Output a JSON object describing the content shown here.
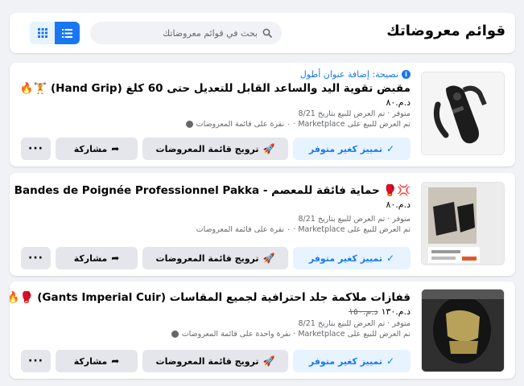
{
  "header": {
    "title": "قوائم معروضاتك",
    "search_placeholder": "بحث في قوائم معروضاتك"
  },
  "buttons": {
    "boost": "تمييز كغير متوفر",
    "promote": "ترويج قائمة المعروضات",
    "share": "مشاركة",
    "more": "···"
  },
  "listings": [
    {
      "tip": "نصيحة: إضافة عنوان أطول",
      "title": "مقبض تقوية اليد والساعد القابل للتعديل حتى 60 كلغ (Hand Grip) 🏋️🔥",
      "price": "د.م.٨٠",
      "old_price": "",
      "status": "متوفر · تم العرض للبيع بتاريخ 8/21",
      "views": "تم العرض للبيع على Marketplace · ٠ نقرة على قائمة المعروضات"
    },
    {
      "tip": "",
      "title": "💢🥊 حماية فائقة للمعصم - Bandes de Poignée Professionnel Pakka",
      "price": "د.م.٨٠",
      "old_price": "",
      "status": "متوفر · تم العرض للبيع بتاريخ 8/21",
      "views": "تم العرض للبيع على Marketplace · ٠ نقرة على قائمة المعروضات"
    },
    {
      "tip": "",
      "title": "قفازات ملاكمة جلد احترافية لجميع المقاسات (Gants Imperial Cuir) 🥊🔥",
      "price": "د.م.١٣٠",
      "old_price": "د.م.١٥٠",
      "status": "متوفر · تم العرض للبيع بتاريخ 8/21",
      "views": "تم العرض للبيع على Marketplace · نقرة واحدة على قائمة المعروضات"
    }
  ],
  "colors": {
    "accent": "#1877f2",
    "page_bg": "#f0f2f5",
    "button_bg": "#e4e6eb",
    "boost_bg": "#e7f3ff"
  }
}
